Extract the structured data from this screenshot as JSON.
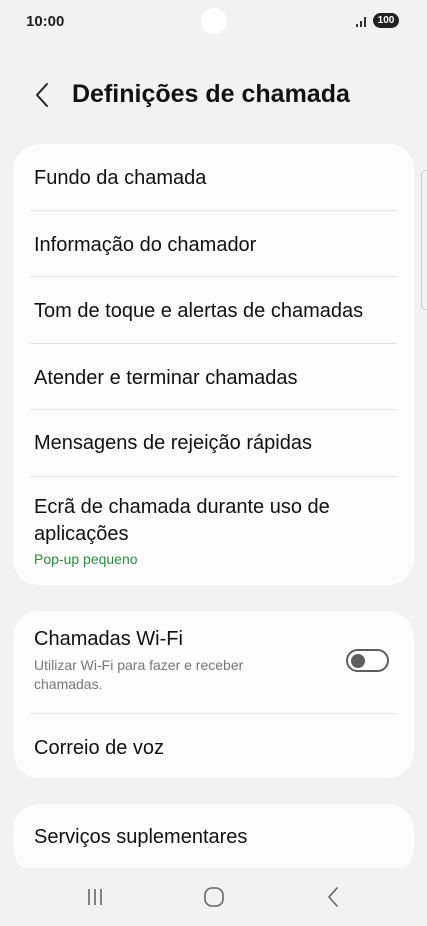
{
  "status_bar": {
    "time": "10:00",
    "signal_icon": "signal-bars-icon",
    "battery": "100"
  },
  "header": {
    "back_icon": "chevron-left-icon",
    "title": "Definições de chamada"
  },
  "card1": {
    "items": [
      {
        "label": "Fundo da chamada"
      },
      {
        "label": "Informação do chamador"
      },
      {
        "label": "Tom de toque e alertas de chamadas"
      },
      {
        "label": "Atender e terminar chamadas"
      },
      {
        "label": "Mensagens de rejeição rápidas"
      },
      {
        "label_line1": "Ecrã de chamada durante uso de",
        "label_line2": "aplicações",
        "sub": "Pop-up pequeno"
      }
    ]
  },
  "card2": {
    "wifi_calling": {
      "label": "Chamadas Wi-Fi",
      "description": "Utilizar Wi-Fi para fazer e receber chamadas.",
      "enabled": false
    },
    "voicemail": {
      "label": "Correio de voz"
    }
  },
  "card3": {
    "supplementary": {
      "label": "Serviços suplementares"
    }
  },
  "nav": {
    "recents_icon": "recent-apps-icon",
    "home_icon": "home-icon",
    "back_icon": "back-icon"
  },
  "colors": {
    "background": "#f2f2f2",
    "card": "#fcfcfc",
    "accent_green": "#2f8a3f",
    "toggle_off": "#5e5e5e"
  }
}
